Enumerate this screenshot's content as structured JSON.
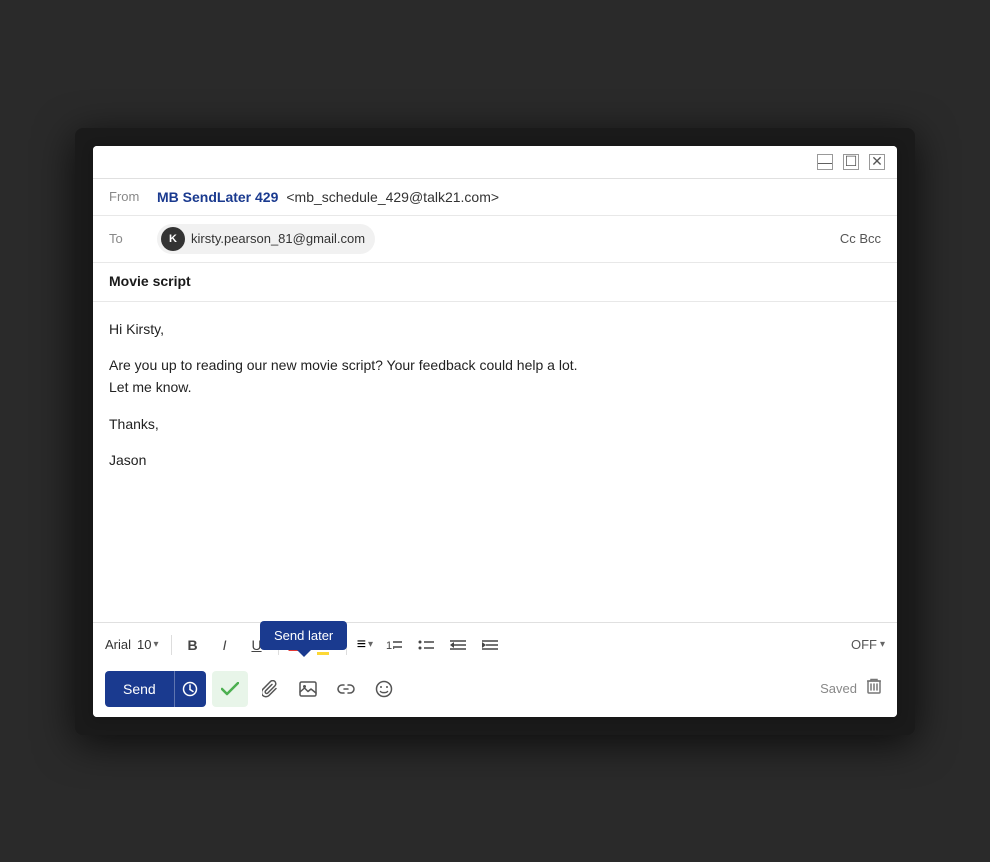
{
  "window": {
    "title_controls": {
      "minimize": "—",
      "maximize": "☐",
      "close": "✕"
    }
  },
  "from_field": {
    "label": "From",
    "sender_name": "MB SendLater 429",
    "sender_email": "<mb_schedule_429@talk21.com>"
  },
  "to_field": {
    "label": "To",
    "recipient_initial": "K",
    "recipient_email": "kirsty.pearson_81@gmail.com",
    "cc_bcc": "Cc Bcc"
  },
  "subject": {
    "text": "Movie script"
  },
  "body": {
    "line1": "Hi Kirsty,",
    "line2": "Are you up to reading our new movie script? Your feedback could help a lot.",
    "line3": "Let me know.",
    "line4": "Thanks,",
    "line5": "Jason"
  },
  "toolbar": {
    "font_name": "Arial",
    "font_size": "10",
    "bold": "B",
    "italic": "I",
    "underline": "U",
    "text_color_label": "A",
    "bg_color_label": "A",
    "align_label": "≡",
    "list_ordered": "≡",
    "list_unordered": "≡",
    "indent_less": "≡",
    "indent_more": "≡",
    "off_toggle": "OFF",
    "send_label": "Send",
    "saved_label": "Saved"
  },
  "tooltip": {
    "send_later": "Send later"
  }
}
